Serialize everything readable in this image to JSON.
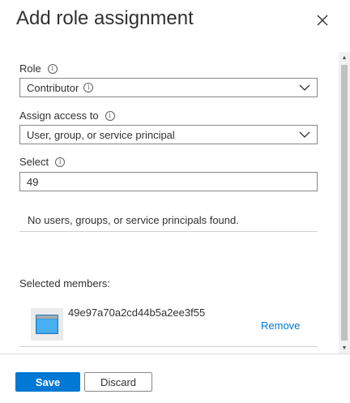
{
  "header": {
    "title": "Add role assignment"
  },
  "form": {
    "role": {
      "label": "Role",
      "value": "Contributor"
    },
    "assign_access": {
      "label": "Assign access to",
      "value": "User, group, or service principal"
    },
    "select": {
      "label": "Select",
      "value": "49"
    },
    "results_message": "No users, groups, or service principals found.",
    "selected_members_label": "Selected members:",
    "members": [
      {
        "id": "49e97a70a2cd44b5a2ee3f55",
        "remove_label": "Remove"
      }
    ]
  },
  "footer": {
    "save_label": "Save",
    "discard_label": "Discard"
  },
  "colors": {
    "accent": "#0078d4",
    "text": "#323130",
    "border": "#8a8886"
  }
}
